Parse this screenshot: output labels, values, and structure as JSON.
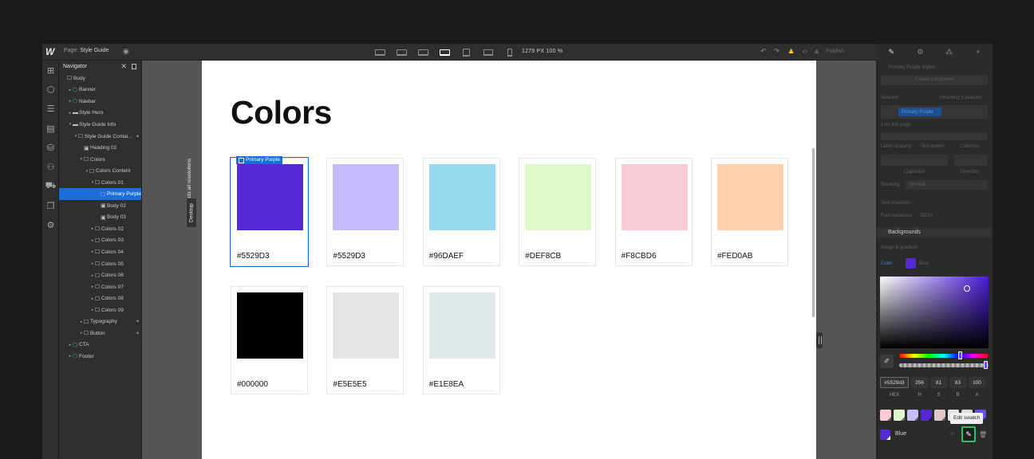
{
  "topbar": {
    "page_prefix": "Page:",
    "page_name": "Style Guide",
    "resolution": "1279 PX  100 %",
    "publish": "Publish"
  },
  "navigator": {
    "title": "Navigator",
    "items": [
      {
        "label": "Body",
        "depth": 0,
        "icon": "box",
        "caret": ""
      },
      {
        "label": "Banner",
        "depth": 1,
        "icon": "component",
        "caret": "▸"
      },
      {
        "label": "Navbar",
        "depth": 1,
        "icon": "component",
        "caret": "▸"
      },
      {
        "label": "Style Hero",
        "depth": 1,
        "icon": "section",
        "caret": "▸"
      },
      {
        "label": "Style Guide Info",
        "depth": 1,
        "icon": "section",
        "caret": "▾"
      },
      {
        "label": "Style Guide Contai...",
        "depth": 2,
        "icon": "box",
        "caret": "▾",
        "bolt": true
      },
      {
        "label": "Heading 02",
        "depth": 3,
        "icon": "text",
        "caret": ""
      },
      {
        "label": "Colors",
        "depth": 3,
        "icon": "box",
        "caret": "▾"
      },
      {
        "label": "Colors Content",
        "depth": 4,
        "icon": "box",
        "caret": "▾"
      },
      {
        "label": "Colors 01",
        "depth": 5,
        "icon": "box",
        "caret": "▾"
      },
      {
        "label": "Primary Purple",
        "depth": 6,
        "icon": "box",
        "caret": "",
        "selected": true
      },
      {
        "label": "Body 02",
        "depth": 6,
        "icon": "text",
        "caret": ""
      },
      {
        "label": "Body 03",
        "depth": 6,
        "icon": "text",
        "caret": ""
      },
      {
        "label": "Colors 02",
        "depth": 5,
        "icon": "box",
        "caret": "▸"
      },
      {
        "label": "Colors 03",
        "depth": 5,
        "icon": "box",
        "caret": "▸"
      },
      {
        "label": "Colors 04",
        "depth": 5,
        "icon": "box",
        "caret": "▸"
      },
      {
        "label": "Colors 05",
        "depth": 5,
        "icon": "box",
        "caret": "▸"
      },
      {
        "label": "Colors 06",
        "depth": 5,
        "icon": "box",
        "caret": "▸"
      },
      {
        "label": "Colors 07",
        "depth": 5,
        "icon": "box",
        "caret": "▸"
      },
      {
        "label": "Colors 08",
        "depth": 5,
        "icon": "box",
        "caret": "▸"
      },
      {
        "label": "Colors 09",
        "depth": 5,
        "icon": "box",
        "caret": "▸"
      },
      {
        "label": "Typography",
        "depth": 3,
        "icon": "box",
        "caret": "▸",
        "bolt": true
      },
      {
        "label": "Button",
        "depth": 3,
        "icon": "box",
        "caret": "▸",
        "bolt": true
      },
      {
        "label": "CTA",
        "depth": 1,
        "icon": "component",
        "caret": "▸"
      },
      {
        "label": "Footer",
        "depth": 1,
        "icon": "component",
        "caret": "▸"
      }
    ]
  },
  "canvas": {
    "vertical_note": "Affects all resolutions",
    "breakpoint": "Desktop",
    "heading": "Colors",
    "selected_tag": "Primary Purple",
    "cards": [
      {
        "hex": "#5529D3",
        "color": "#5529D3"
      },
      {
        "hex": "#5529D3",
        "color": "#C6BBFB"
      },
      {
        "hex": "#96DAEF",
        "color": "#96DAEF"
      },
      {
        "hex": "#DEF8CB",
        "color": "#DEF8CB"
      },
      {
        "hex": "#F8CBD6",
        "color": "#F8CBD6"
      },
      {
        "hex": "#FED0AB",
        "color": "#FED0AB"
      },
      {
        "hex": "#000000",
        "color": "#000000"
      },
      {
        "hex": "#E5E5E5",
        "color": "#E5E5E5"
      },
      {
        "hex": "#E1E8EA",
        "color": "#E1E8EA"
      }
    ]
  },
  "style_panel": {
    "styles_title": "Primary Purple Styles",
    "create_component": "Create component",
    "selector_label": "Selector",
    "inheriting": "Inheriting 1 selector",
    "selector_chip": "Primary Purple",
    "on_this_page": "1 on this page",
    "letter_spacing": "Letter spacing",
    "text_indent": "Text indent",
    "columns": "Columns",
    "capitalize": "Capitalize",
    "direction": "Direction",
    "breaking_label": "Breaking",
    "breaking_value": "Normal",
    "text_shadows": "Text shadows",
    "font_variations": "Font variations",
    "beta": "BETA",
    "backgrounds": "Backgrounds",
    "image_gradient": "Image & gradient",
    "color_label": "Color",
    "color_value": "Blue"
  },
  "color_picker": {
    "hex_value": "#5529d3",
    "h": "256",
    "s": "81",
    "b": "83",
    "a": "100",
    "labels": [
      "HEX",
      "H",
      "S",
      "B",
      "A"
    ],
    "swatches": [
      "#F8CBD6",
      "#DEF8CB",
      "#C6BBFB",
      "#5529D3",
      "#E1C9C9",
      "#E5E5E5",
      "#DDDDDD",
      "#6C4FE0"
    ],
    "swatch_name": "Blue",
    "tooltip": "Edit swatch"
  }
}
